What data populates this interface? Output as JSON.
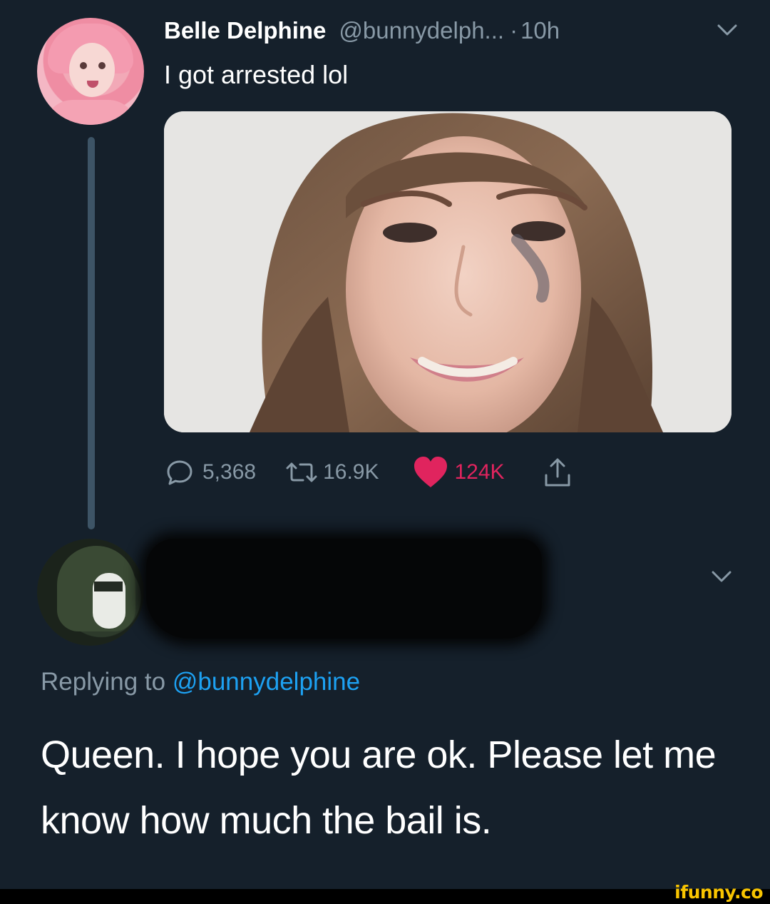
{
  "tweet": {
    "author_name": "Belle Delphine",
    "author_handle": "@bunnydelph...",
    "separator": "·",
    "time": "10h",
    "text": "I got arrested lol",
    "stats": {
      "replies": "5,368",
      "retweets": "16.9K",
      "likes": "124K"
    }
  },
  "reply": {
    "replying_prefix": "Replying to",
    "replying_mention": "@bunnydelphine",
    "text": "Queen. I hope you are ok. Please let me know how much the bail is."
  },
  "watermark": "ifunny.co",
  "icons": [
    "chevron-down-icon",
    "reply-icon",
    "retweet-icon",
    "heart-icon",
    "share-icon"
  ],
  "colors": {
    "background": "#15202b",
    "text_primary": "#ffffff",
    "text_secondary": "#8899a6",
    "link": "#1da1f2",
    "like": "#e0245e",
    "watermark": "#f8c400"
  }
}
